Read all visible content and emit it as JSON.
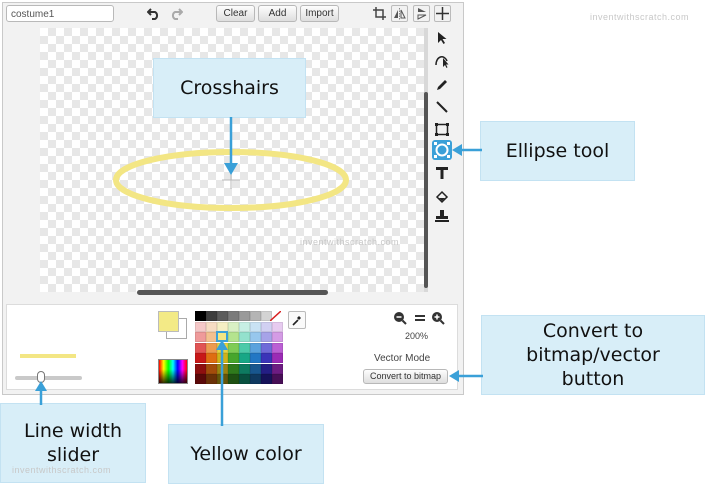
{
  "toolbar": {
    "costume_name": "costume1",
    "clear_label": "Clear",
    "add_label": "Add",
    "import_label": "Import"
  },
  "zoom": {
    "level_label": "200%"
  },
  "mode": {
    "label": "Vector Mode",
    "convert_button_label": "Convert to bitmap"
  },
  "callouts": {
    "crosshairs": "Crosshairs",
    "ellipse_tool": "Ellipse tool",
    "convert_button": "Convert to bitmap/vector button",
    "line_width": "Line width slider",
    "yellow_color": "Yellow color"
  },
  "watermarks": {
    "top_right": "inventwithscratch.com",
    "canvas": "inventwithscratch.com",
    "bottom_left": "inventwithscratch.com"
  },
  "colors": {
    "accent_blue": "#3aa0d8",
    "callout_bg": "#d8eef8",
    "ellipse_stroke": "#f3e684",
    "selected_color": "#f3ea86"
  },
  "palette": {
    "grays": [
      "#000000",
      "#3d3d3d",
      "#5c5c5c",
      "#7b7b7b",
      "#9a9a9a",
      "#b5b5b5",
      "#d3d3d3",
      "#f3f3f3"
    ],
    "rows": [
      [
        "#f5c8c8",
        "#f6dcc3",
        "#f5efc4",
        "#d9f0c4",
        "#c7efe4",
        "#c9e2f4",
        "#d1d0f2",
        "#e7cbf0"
      ],
      [
        "#ef9a9a",
        "#f3c08f",
        "#f3e684",
        "#b4e38e",
        "#93e1cd",
        "#97c7ed",
        "#a6a3e8",
        "#d49be5"
      ],
      [
        "#e15454",
        "#ec9a4f",
        "#e7d341",
        "#7fcc55",
        "#4ccaa9",
        "#5aa2dd",
        "#6f6ad8",
        "#bb5fd4"
      ],
      [
        "#c81818",
        "#df6d12",
        "#d0b21a",
        "#47a62c",
        "#18a786",
        "#2277c4",
        "#3b34b8",
        "#9b2bb5"
      ],
      [
        "#8e0f0f",
        "#a34c0b",
        "#9a8210",
        "#2f7a1c",
        "#0e7a60",
        "#18568e",
        "#241e84",
        "#6d1c82"
      ],
      [
        "#5b0909",
        "#6a3107",
        "#645509",
        "#1e5012",
        "#08503f",
        "#0f3960",
        "#161259",
        "#470f56"
      ]
    ]
  }
}
